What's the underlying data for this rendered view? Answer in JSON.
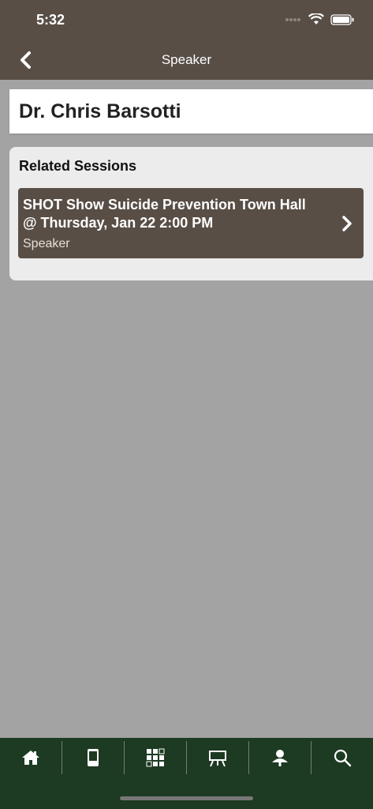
{
  "status": {
    "time": "5:32"
  },
  "nav": {
    "title": "Speaker"
  },
  "speaker": {
    "name": "Dr. Chris Barsotti"
  },
  "sessions": {
    "heading": "Related Sessions",
    "items": [
      {
        "title": "SHOT Show Suicide Prevention Town Hall @ Thursday, Jan 22 2:00 PM",
        "role": "Speaker"
      }
    ]
  },
  "tabs": [
    "home-icon",
    "mobile-device-icon",
    "grid-icon",
    "presentation-board-icon",
    "speaker-icon",
    "search-icon"
  ],
  "colors": {
    "header": "#584e46",
    "tabbar": "#1d3a22",
    "background": "#a3a3a3"
  }
}
